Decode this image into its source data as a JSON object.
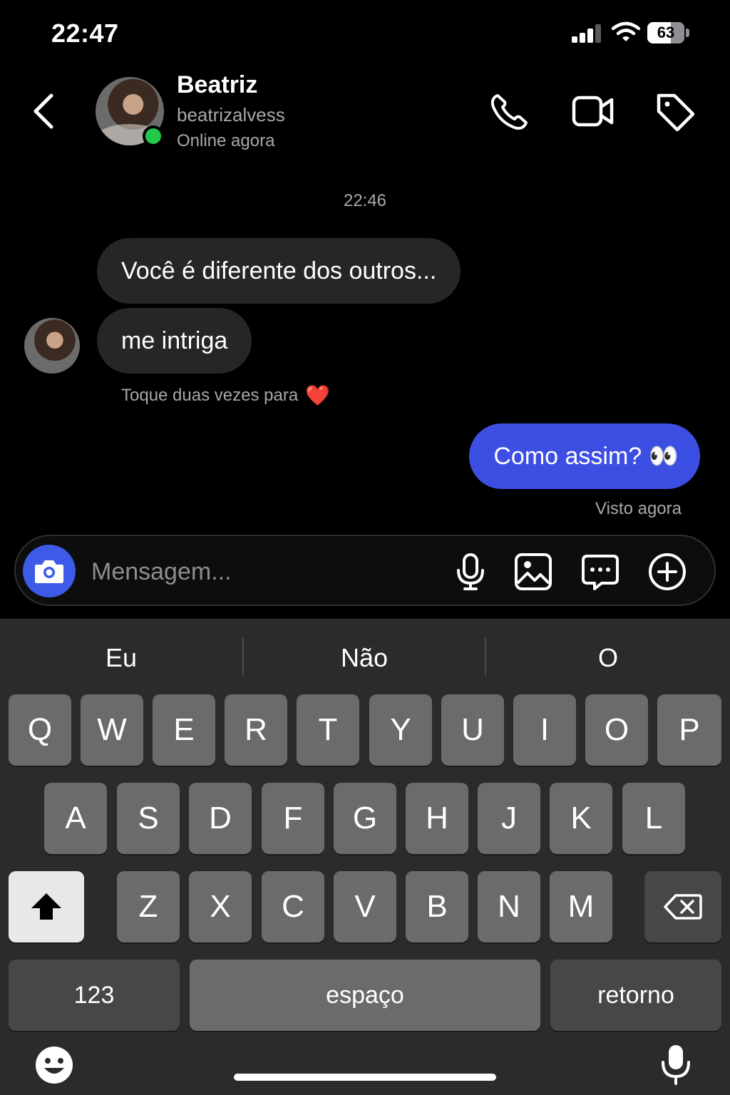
{
  "status_bar": {
    "time": "22:47",
    "battery": "63"
  },
  "header": {
    "name": "Beatriz",
    "username": "beatrizalvess",
    "status": "Online agora"
  },
  "chat": {
    "timestamp": "22:46",
    "incoming": [
      "Você é diferente dos outros...",
      "me intriga"
    ],
    "hint": "Toque duas vezes para",
    "hint_emoji": "❤️",
    "outgoing": "Como assim? 👀",
    "seen": "Visto agora"
  },
  "composer": {
    "placeholder": "Mensagem..."
  },
  "keyboard": {
    "suggestions": [
      "Eu",
      "Não",
      "O"
    ],
    "row1": [
      "Q",
      "W",
      "E",
      "R",
      "T",
      "Y",
      "U",
      "I",
      "O",
      "P"
    ],
    "row2": [
      "A",
      "S",
      "D",
      "F",
      "G",
      "H",
      "J",
      "K",
      "L"
    ],
    "row3": [
      "Z",
      "X",
      "C",
      "V",
      "B",
      "N",
      "M"
    ],
    "numbers": "123",
    "space": "espaço",
    "return": "retorno"
  },
  "colors": {
    "accent": "#3d4ee3",
    "online": "#22c84a",
    "incoming_bubble": "#262626",
    "heart": "#e0243a"
  },
  "icons": [
    "back-icon",
    "phone-icon",
    "video-icon",
    "tag-icon",
    "camera-icon",
    "microphone-icon",
    "gallery-icon",
    "sticker-icon",
    "plus-icon",
    "shift-icon",
    "delete-icon",
    "emoji-icon",
    "dictation-icon"
  ]
}
